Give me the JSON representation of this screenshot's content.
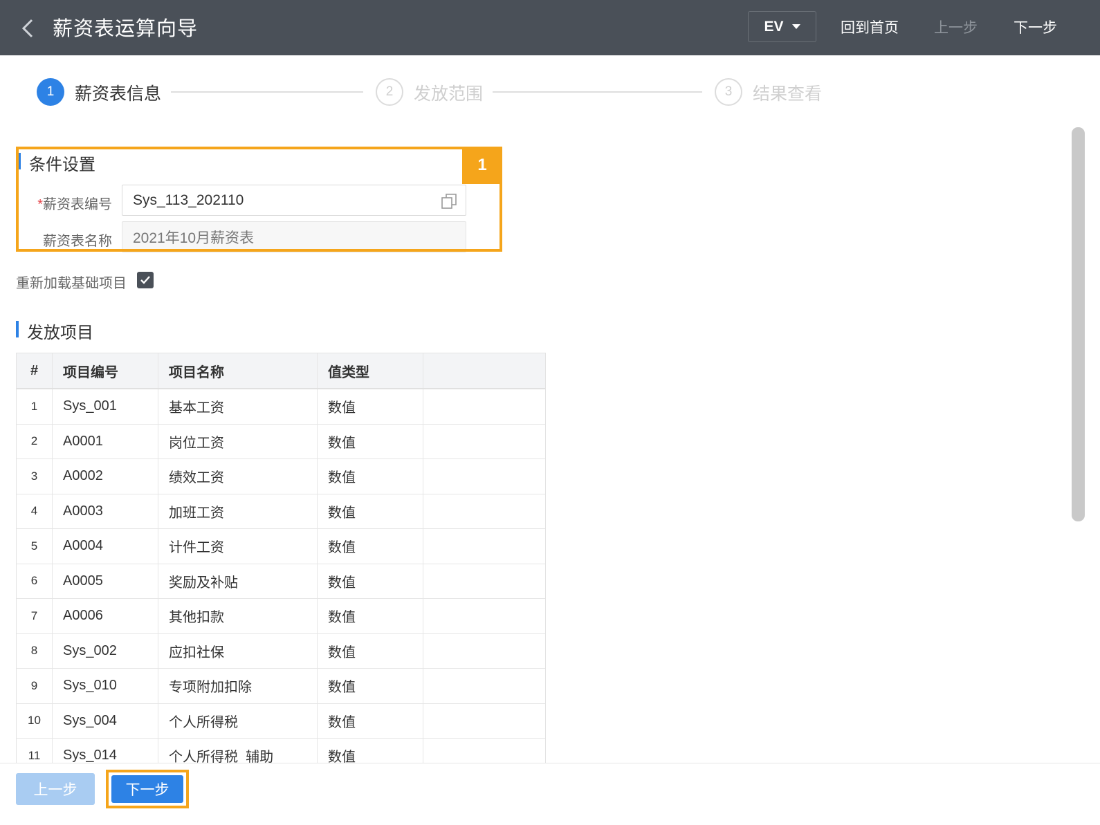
{
  "header": {
    "title": "薪资表运算向导",
    "env": "EV",
    "home": "回到首页",
    "prev": "上一步",
    "next": "下一步"
  },
  "steps": [
    {
      "num": "1",
      "label": "薪资表信息"
    },
    {
      "num": "2",
      "label": "发放范围"
    },
    {
      "num": "3",
      "label": "结果查看"
    }
  ],
  "conditions": {
    "title": "条件设置",
    "badge": "1",
    "code_label_required": "*",
    "code_label": "薪资表编号",
    "code_value": "Sys_113_202110",
    "name_label": "薪资表名称",
    "name_value": "2021年10月薪资表"
  },
  "reload": {
    "label": "重新加载基础项目",
    "checked": true
  },
  "items": {
    "title": "发放项目",
    "columns": [
      "#",
      "项目编号",
      "项目名称",
      "值类型",
      ""
    ],
    "rows": [
      [
        "1",
        "Sys_001",
        "基本工资",
        "数值"
      ],
      [
        "2",
        "A0001",
        "岗位工资",
        "数值"
      ],
      [
        "3",
        "A0002",
        "绩效工资",
        "数值"
      ],
      [
        "4",
        "A0003",
        "加班工资",
        "数值"
      ],
      [
        "5",
        "A0004",
        "计件工资",
        "数值"
      ],
      [
        "6",
        "A0005",
        "奖励及补贴",
        "数值"
      ],
      [
        "7",
        "A0006",
        "其他扣款",
        "数值"
      ],
      [
        "8",
        "Sys_002",
        "应扣社保",
        "数值"
      ],
      [
        "9",
        "Sys_010",
        "专项附加扣除",
        "数值"
      ],
      [
        "10",
        "Sys_004",
        "个人所得税",
        "数值"
      ],
      [
        "11",
        "Sys_014",
        "个人所得税_辅助",
        "数值"
      ]
    ]
  },
  "footer": {
    "prev": "上一步",
    "next": "下一步"
  },
  "colors": {
    "primary": "#2d82e5",
    "highlight": "#f5a51b",
    "topbar": "#4a5058"
  }
}
